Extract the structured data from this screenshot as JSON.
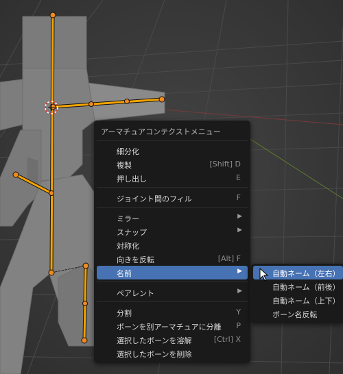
{
  "viewport": {
    "background": "#3a3a3a",
    "bone_color": "#f5a400",
    "joint_color": "#f08a1f"
  },
  "context_menu": {
    "title": "アーマチュアコンテクストメニュー",
    "items": [
      {
        "label": "細分化",
        "shortcut": ""
      },
      {
        "label": "複製",
        "shortcut": "[Shift] D"
      },
      {
        "label": "押し出し",
        "shortcut": "E"
      },
      {
        "label": "ジョイント間のフィル",
        "shortcut": "F"
      },
      {
        "label": "ミラー",
        "submenu": true
      },
      {
        "label": "スナップ",
        "submenu": true
      },
      {
        "label": "対称化",
        "shortcut": ""
      },
      {
        "label": "向きを反転",
        "shortcut": "[Alt] F"
      },
      {
        "label": "名前",
        "submenu": true,
        "active": true
      },
      {
        "label": "ペアレント",
        "submenu": true
      },
      {
        "label": "分割",
        "shortcut": "Y"
      },
      {
        "label": "ボーンを別アーマチュアに分離",
        "shortcut": "P"
      },
      {
        "label": "選択したボーンを溶解",
        "shortcut": "[Ctrl] X"
      },
      {
        "label": "選択したボーンを削除",
        "shortcut": ""
      }
    ]
  },
  "name_submenu": {
    "items": [
      {
        "label": "自動ネーム（左右）",
        "hover": true
      },
      {
        "label": "自動ネーム（前後）"
      },
      {
        "label": "自動ネーム（上下）"
      },
      {
        "label": "ボーン名反転"
      }
    ]
  }
}
